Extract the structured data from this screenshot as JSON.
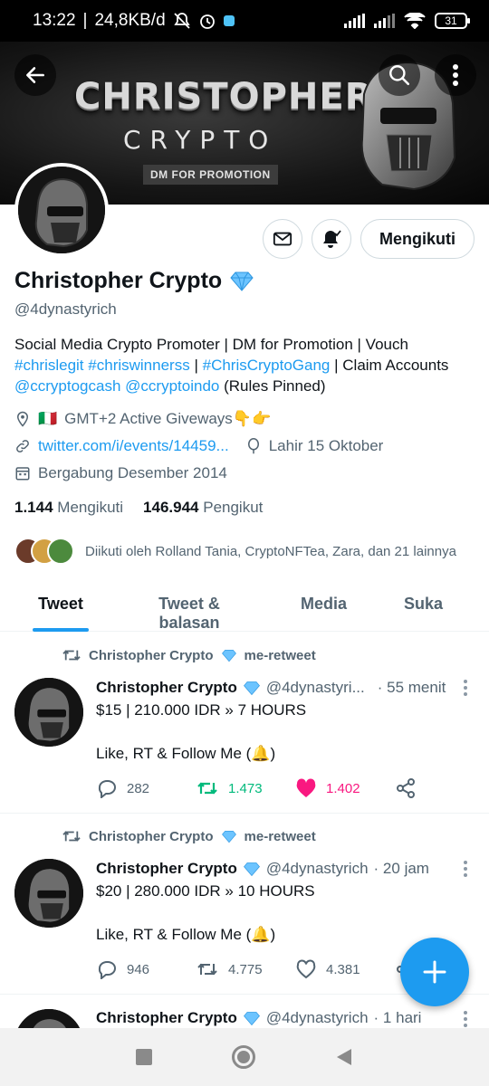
{
  "status_bar": {
    "time": "13:22",
    "net_speed": "24,8KB/d",
    "battery": "31",
    "separator": "|"
  },
  "banner": {
    "title": "CHRISTOPHER",
    "subtitle": "CRYPTO",
    "tag": "DM FOR PROMOTION"
  },
  "profile": {
    "name": "Christopher Crypto",
    "handle": "@4dynastyrich",
    "follow_label": "Mengikuti",
    "bio_line1": "Social Media Crypto Promoter | DM for Promotion | Vouch",
    "bio_hashtag1": "#chrislegit",
    "bio_hashtag2": "#chriswinnerss",
    "bio_sep": "|",
    "bio_hashtag3": "#ChrisCryptoGang",
    "bio_claim": "| Claim Accounts",
    "bio_mention1": "@ccryptogcash",
    "bio_mention2": "@ccryptoindo",
    "bio_rules": "(Rules Pinned)",
    "location_flag": "🇮🇹",
    "location": "GMT+2 Active Giveways👇👉",
    "website": "twitter.com/i/events/14459...",
    "birthday": "Lahir 15 Oktober",
    "joined": "Bergabung Desember 2014",
    "following_count": "1.144",
    "following_label": "Mengikuti",
    "followers_count": "146.944",
    "followers_label": "Pengikut",
    "followed_by": "Diikuti oleh Rolland Tania, CryptoNFTea, Zara, dan 21 lainnya"
  },
  "tabs": [
    {
      "label": "Tweet"
    },
    {
      "label": "Tweet & balasan"
    },
    {
      "label": "Media"
    },
    {
      "label": "Suka"
    }
  ],
  "tweets": [
    {
      "retweet_by": "Christopher Crypto",
      "retweet_suffix": "me-retweet",
      "name": "Christopher Crypto",
      "handle": "@4dynastyri...",
      "time": "· 55 menit",
      "text": "$15 | 210.000 IDR » 7 HOURS\n\nLike, RT & Follow Me (🔔)",
      "replies": "282",
      "retweets": "1.473",
      "likes": "1.402"
    },
    {
      "retweet_by": "Christopher Crypto",
      "retweet_suffix": "me-retweet",
      "name": "Christopher Crypto",
      "handle": "@4dynastyrich",
      "time": "· 20 jam",
      "text": "$20 | 280.000 IDR » 10 HOURS\n\nLike, RT & Follow Me (🔔)",
      "replies": "946",
      "retweets": "4.775",
      "likes": "4.381"
    },
    {
      "name": "Christopher Crypto",
      "handle": "@4dynastyrich",
      "time": "· 1 hari"
    }
  ],
  "colors": {
    "accent": "#1d9bf0",
    "retweet_green": "#00ba7c",
    "like_pink": "#f91880",
    "text_secondary": "#536471"
  }
}
